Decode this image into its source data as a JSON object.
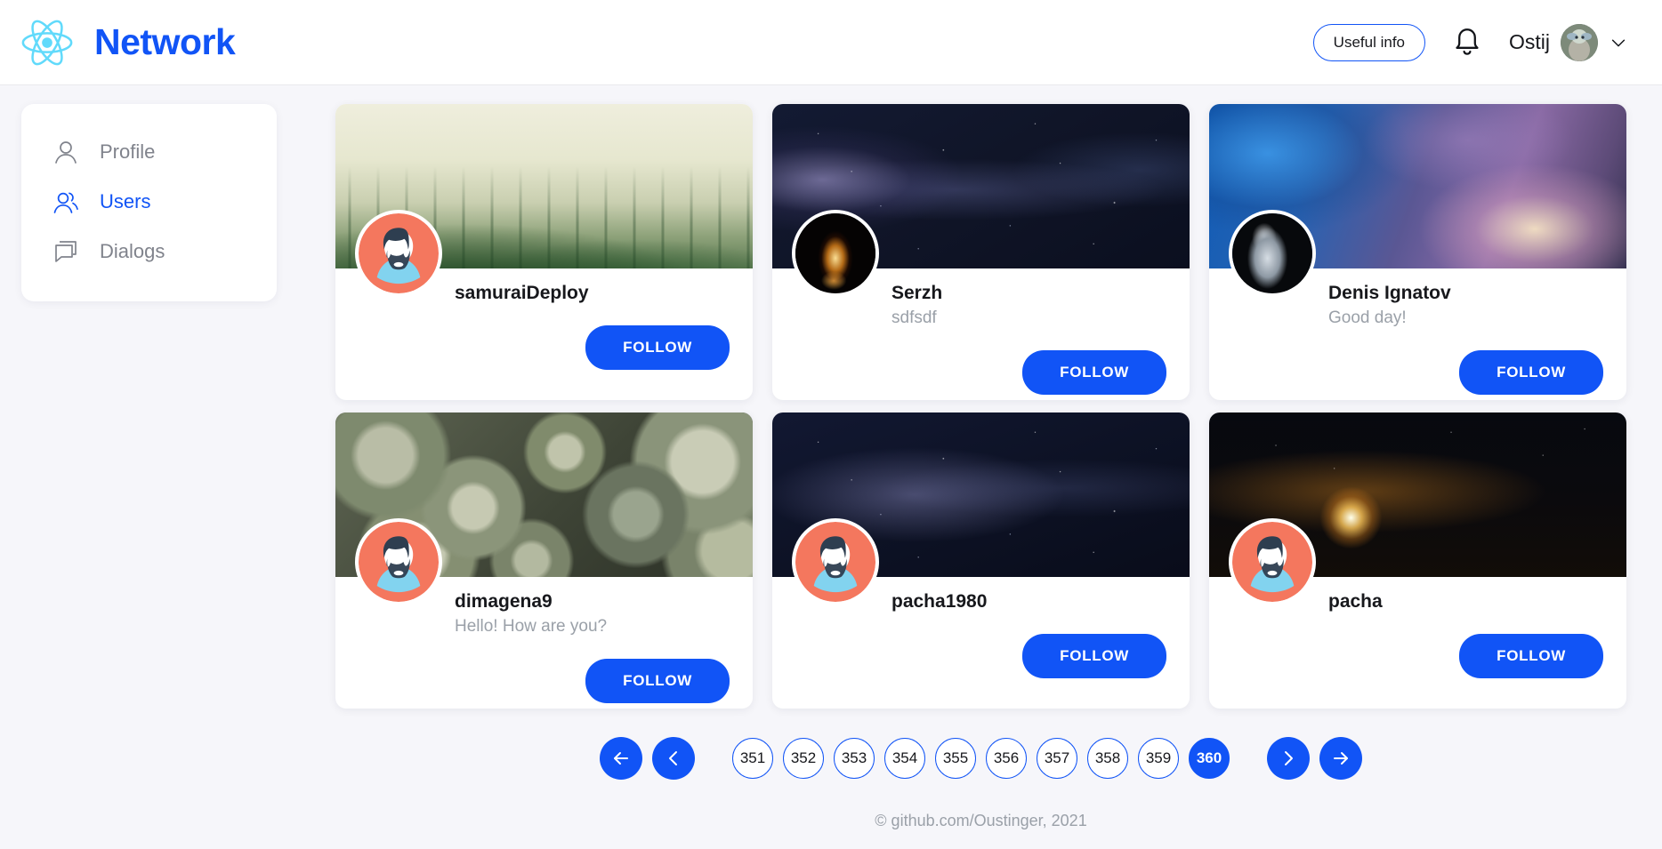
{
  "header": {
    "logo_icon": "react-atom-icon",
    "brand": "Network",
    "useful_info_label": "Useful info",
    "bell_icon": "bell-icon",
    "user_name": "Ostij",
    "avatar_icon": "user-avatar",
    "chevron_icon": "chevron-down-icon"
  },
  "sidebar": {
    "items": [
      {
        "label": "Profile",
        "icon": "person-icon",
        "active": false
      },
      {
        "label": "Users",
        "icon": "people-icon",
        "active": true
      },
      {
        "label": "Dialogs",
        "icon": "chat-bubble-icon",
        "active": false
      }
    ]
  },
  "users": [
    {
      "name": "samuraiDeploy",
      "status": "",
      "cover": "cover-forest",
      "avatar": "default",
      "follow_label": "FOLLOW"
    },
    {
      "name": "Serzh",
      "status": "sdfsdf",
      "cover": "cover-galaxy",
      "avatar": "fire",
      "follow_label": "FOLLOW"
    },
    {
      "name": "Denis Ignatov",
      "status": "Good day!",
      "cover": "cover-storm",
      "avatar": "robot",
      "follow_label": "FOLLOW"
    },
    {
      "name": "dimagena9",
      "status": "Hello! How are you?",
      "cover": "cover-succulent",
      "avatar": "default",
      "follow_label": "FOLLOW"
    },
    {
      "name": "pacha1980",
      "status": "",
      "cover": "cover-galaxy2",
      "avatar": "default",
      "follow_label": "FOLLOW"
    },
    {
      "name": "pacha",
      "status": "",
      "cover": "cover-earth",
      "avatar": "default",
      "follow_label": "FOLLOW"
    }
  ],
  "pagination": {
    "first_icon": "arrow-left-icon",
    "prev_icon": "chevron-left-icon",
    "next_icon": "chevron-right-icon",
    "last_icon": "arrow-right-icon",
    "pages": [
      "351",
      "352",
      "353",
      "354",
      "355",
      "356",
      "357",
      "358",
      "359",
      "360"
    ],
    "current": "360"
  },
  "footer": {
    "text": "© github.com/Oustinger, 2021"
  },
  "colors": {
    "accent": "#1154f6",
    "logo_cyan": "#61dafb",
    "page_bg": "#f6f6fa",
    "muted_text": "#9aa0a8",
    "avatar_bg": "#f4775e",
    "avatar_shirt": "#82d3ef",
    "avatar_hair": "#2e3e50"
  }
}
